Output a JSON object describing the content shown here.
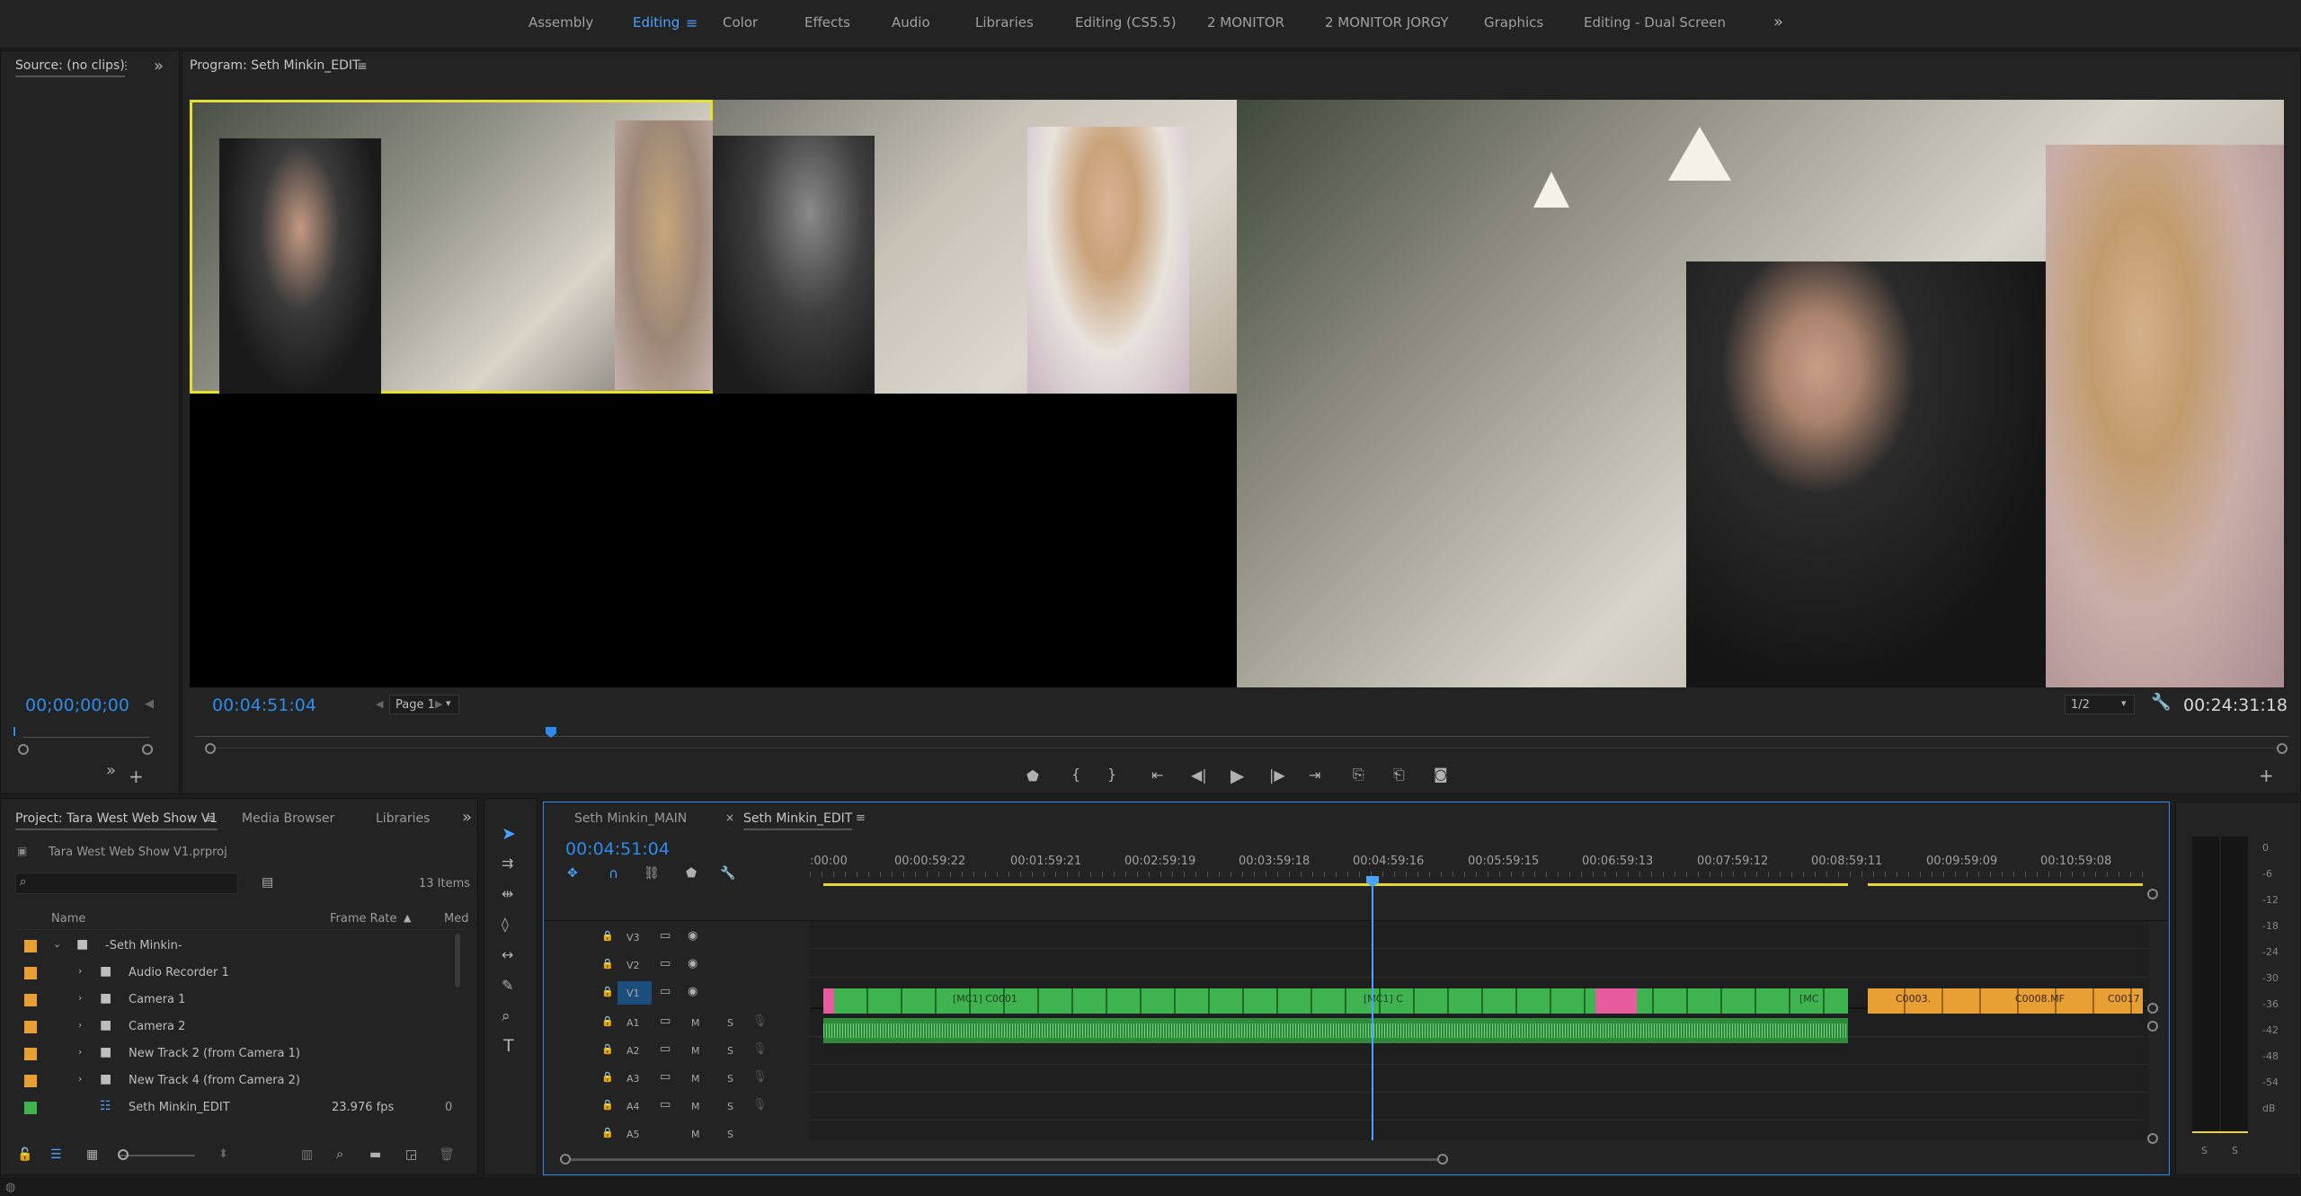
{
  "workspaces": [
    "Assembly",
    "Editing",
    "Color",
    "Effects",
    "Audio",
    "Libraries",
    "Editing (CS5.5)",
    "2 MONITOR",
    "2 MONITOR JORGY",
    "Graphics",
    "Editing - Dual Screen"
  ],
  "workspace_active": "Editing",
  "source_monitor": {
    "title": "Source: (no clips)",
    "timecode": "00;00;00;00"
  },
  "program_monitor": {
    "title": "Program: Seth Minkin_EDIT",
    "timecode": "00:04:51:04",
    "page": "Page 1",
    "zoom": "1/2",
    "duration": "00:24:31:18"
  },
  "project": {
    "tabs": [
      "Project: Tara West Web Show V1",
      "Media Browser",
      "Libraries"
    ],
    "file": "Tara West Web Show V1.prproj",
    "items_count": "13 Items",
    "columns": {
      "name": "Name",
      "frame_rate": "Frame Rate",
      "media": "Med"
    },
    "rows": [
      {
        "name": "-Seth Minkin-",
        "type": "bin",
        "color": "#e8a035",
        "fps": ""
      },
      {
        "name": "Audio Recorder 1",
        "type": "bin",
        "color": "#e8a035",
        "fps": ""
      },
      {
        "name": "Camera 1",
        "type": "bin",
        "color": "#e8a035",
        "fps": ""
      },
      {
        "name": "Camera 2",
        "type": "bin",
        "color": "#e8a035",
        "fps": ""
      },
      {
        "name": "New Track 2 (from Camera 1)",
        "type": "bin",
        "color": "#e8a035",
        "fps": ""
      },
      {
        "name": "New Track 4 (from Camera 2)",
        "type": "bin",
        "color": "#e8a035",
        "fps": ""
      },
      {
        "name": "Seth Minkin_EDIT",
        "type": "sequence",
        "color": "#3fb34f",
        "fps": "23.976 fps"
      }
    ]
  },
  "timeline": {
    "tabs": [
      "Seth Minkin_MAIN",
      "Seth Minkin_EDIT"
    ],
    "timecode": "00:04:51:04",
    "ruler": [
      ":00:00",
      "00:00:59:22",
      "00:01:59:21",
      "00:02:59:19",
      "00:03:59:18",
      "00:04:59:16",
      "00:05:59:15",
      "00:06:59:13",
      "00:07:59:12",
      "00:08:59:11",
      "00:09:59:09",
      "00:10:59:08"
    ],
    "video_tracks": [
      "V3",
      "V2",
      "V1"
    ],
    "audio_tracks": [
      "A1",
      "A2",
      "A3",
      "A4",
      "A5"
    ],
    "clip_labels": [
      "[MC1] C0001",
      "[MC1] C",
      "[MC",
      "C0003.",
      "C0008.MF",
      "C0017"
    ]
  },
  "audio_meter": {
    "scale": [
      "0",
      "-6",
      "-12",
      "-18",
      "-24",
      "-30",
      "-36",
      "-42",
      "-48",
      "-54",
      "dB"
    ],
    "solo": [
      "S",
      "S"
    ]
  },
  "colors": {
    "accent": "#2d8ceb",
    "clip_green": "#3fb34f",
    "clip_orange": "#e8a035",
    "clip_pink": "#e65b9e",
    "playhead": "#4aa3ff",
    "work_area": "#e6d72a"
  }
}
